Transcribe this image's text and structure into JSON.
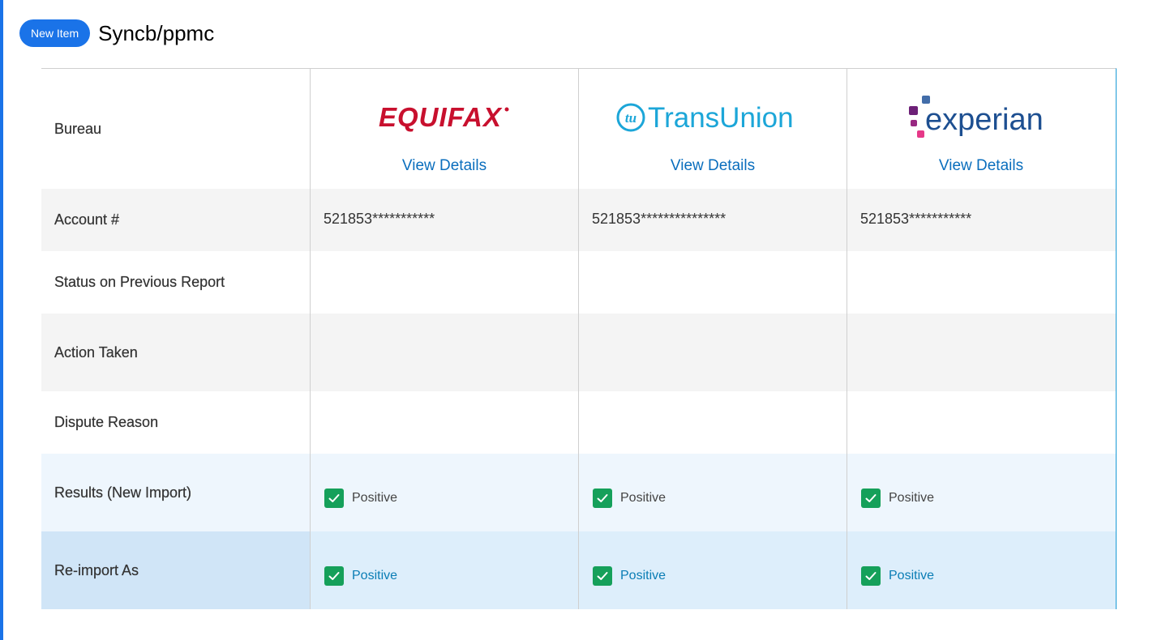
{
  "header": {
    "badge": "New Item",
    "title": "Syncb/ppmc"
  },
  "rows": {
    "bureau": "Bureau",
    "account": "Account #",
    "status": "Status on Previous Report",
    "action": "Action Taken",
    "dispute": "Dispute Reason",
    "results": "Results (New Import)",
    "reimport": "Re-import As"
  },
  "bureaus": [
    {
      "logo_text": "EQUIFAX",
      "view_details": "View Details",
      "account": "521853***********",
      "result": "Positive",
      "reimport": "Positive"
    },
    {
      "logo_text": "TransUnion",
      "logo_mark": "tu",
      "view_details": "View Details",
      "account": "521853***************",
      "result": "Positive",
      "reimport": "Positive"
    },
    {
      "logo_text": "experian",
      "view_details": "View Details",
      "account": "521853***********",
      "result": "Positive",
      "reimport": "Positive"
    }
  ],
  "colors": {
    "accent": "#1a73e8",
    "link": "#0a6ebd",
    "check": "#15a05a",
    "equifax": "#c8102e",
    "transunion": "#1ca6d8",
    "experian_text": "#1d4f91"
  }
}
